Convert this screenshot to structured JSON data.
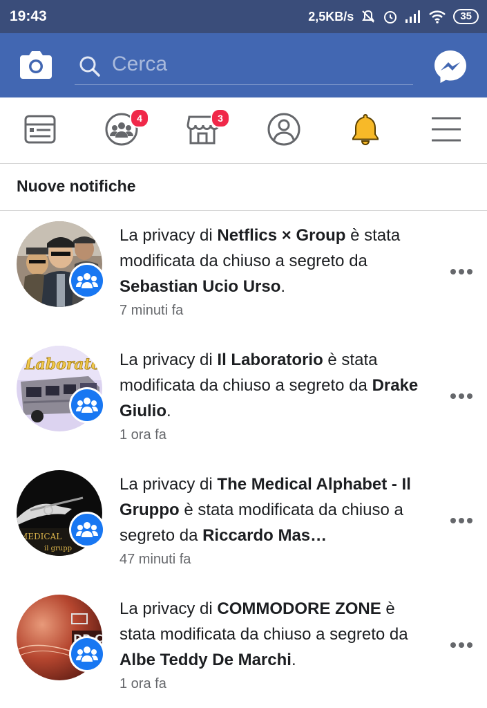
{
  "status_bar": {
    "time": "19:43",
    "net_speed": "2,5KB/s",
    "battery": "35",
    "icons": [
      "mute-icon",
      "alarm-icon",
      "signal-icon",
      "wifi-icon",
      "battery-icon"
    ]
  },
  "header": {
    "search_placeholder": "Cerca",
    "brand_color": "#4267b2"
  },
  "tabs": [
    {
      "name": "news-feed-icon",
      "badge": ""
    },
    {
      "name": "groups-icon",
      "badge": "4"
    },
    {
      "name": "marketplace-icon",
      "badge": "3"
    },
    {
      "name": "profile-icon",
      "badge": ""
    },
    {
      "name": "notifications-bell-icon",
      "badge": ""
    },
    {
      "name": "menu-icon",
      "badge": ""
    }
  ],
  "section_title": "Nuove notifiche",
  "notifications": [
    {
      "prefix": "La privacy di ",
      "group": "Netflics × Group",
      "middle": " è stata modificata da chiuso a segreto da ",
      "user": "Sebastian Ucio Urso",
      "suffix": ".",
      "time": "7 minuti fa"
    },
    {
      "prefix": "La privacy di ",
      "group": "Il Laboratorio",
      "middle": " è stata modificata da chiuso a segreto da ",
      "user": "Drake Giulio",
      "suffix": ".",
      "time": "1 ora fa"
    },
    {
      "prefix": "La privacy di ",
      "group": "The Medical Alphabet - Il Gruppo",
      "middle": " è stata modificata da chiuso a segreto da ",
      "user": "Riccardo Mas…",
      "suffix": "",
      "time": "47 minuti fa"
    },
    {
      "prefix": "La privacy di ",
      "group": "COMMODORE ZONE",
      "middle": " è stata modificata da chiuso a segreto da ",
      "user": "Albe Teddy De Marchi",
      "suffix": ".",
      "time": "1 ora fa"
    }
  ]
}
